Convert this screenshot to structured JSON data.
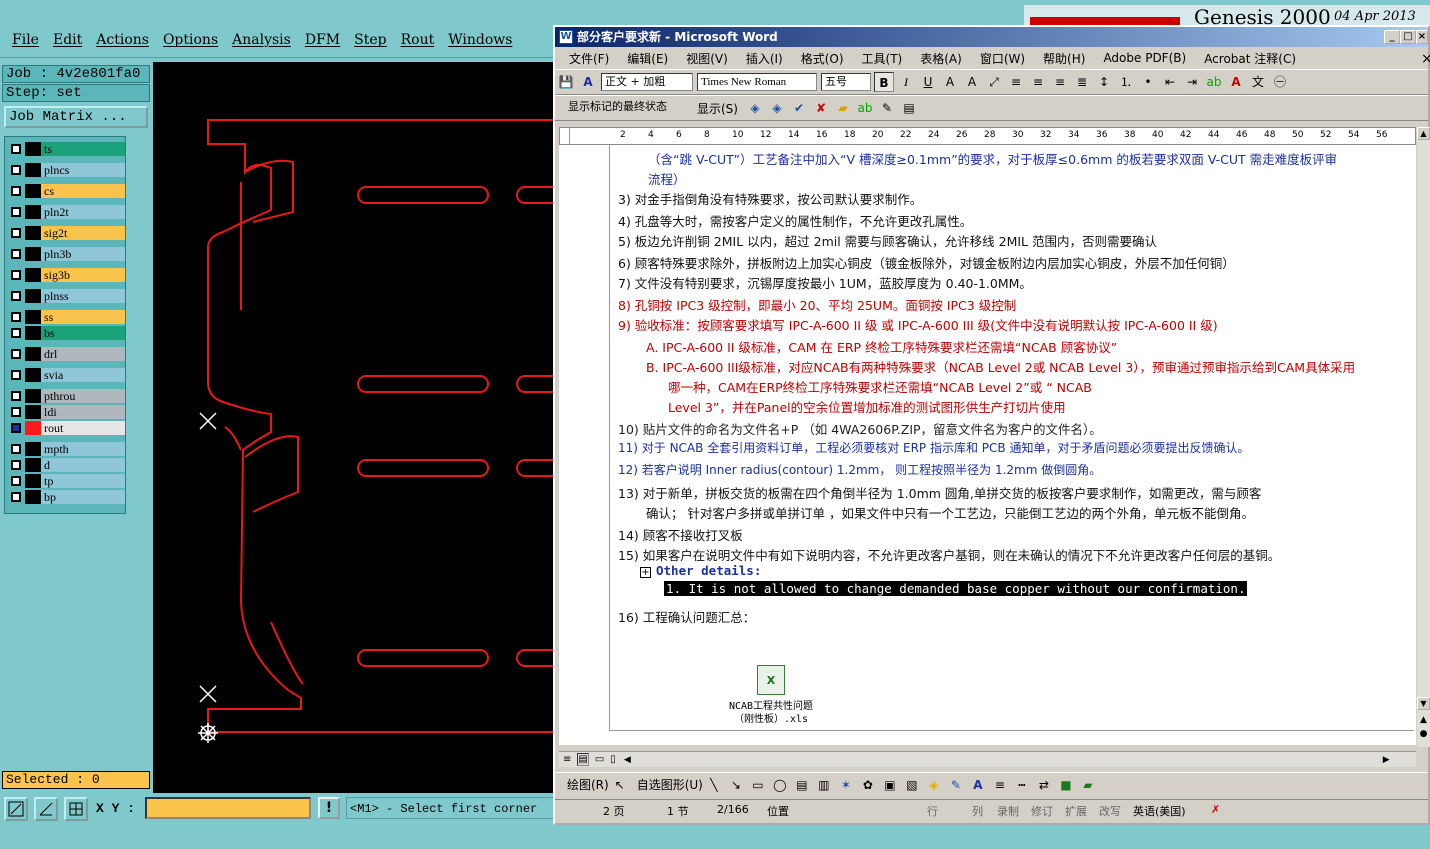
{
  "genesis": {
    "menu": [
      "File",
      "Edit",
      "Actions",
      "Options",
      "Analysis",
      "DFM",
      "Step",
      "Rout",
      "Windows"
    ],
    "job_label": "Job : 4v2e801fa0",
    "step_label": "Step: set",
    "job_matrix_button": "Job Matrix ...",
    "layers": [
      {
        "name": "ts",
        "color": "#1aa37a",
        "checked": false
      },
      {
        "name": "plncs",
        "color": "#8fc7d9",
        "checked": false
      },
      {
        "name": "cs",
        "color": "#f9c34c",
        "checked": false
      },
      {
        "name": "pln2t",
        "color": "#8fc7d9",
        "checked": false
      },
      {
        "name": "sig2t",
        "color": "#f9c34c",
        "checked": false
      },
      {
        "name": "pln3b",
        "color": "#8fc7d9",
        "checked": false
      },
      {
        "name": "sig3b",
        "color": "#f9c34c",
        "checked": false
      },
      {
        "name": "plnss",
        "color": "#8fc7d9",
        "checked": false
      },
      {
        "name": "ss",
        "color": "#f9c34c",
        "checked": false
      },
      {
        "name": "bs",
        "color": "#1aa37a",
        "checked": false
      },
      {
        "name": "drl",
        "color": "#b0b7bd",
        "checked": false
      },
      {
        "name": "svia",
        "color": "#8fc7d9",
        "checked": false
      },
      {
        "name": "pthrou",
        "color": "#b0b7bd",
        "checked": false
      },
      {
        "name": "ldi",
        "color": "#b0b7bd",
        "checked": false
      },
      {
        "name": "rout",
        "color": "#e6e6e6",
        "checked": true,
        "active_swatch": "#ff1a1a"
      },
      {
        "name": "mpth",
        "color": "#8fc7d9",
        "checked": false
      },
      {
        "name": "d",
        "color": "#8fc7d9",
        "checked": false
      },
      {
        "name": "tp",
        "color": "#8fc7d9",
        "checked": false
      },
      {
        "name": "bp",
        "color": "#8fc7d9",
        "checked": false
      }
    ],
    "selected_label": "Selected : 0",
    "xy_label": "X Y :",
    "xy_value": "",
    "bang_label": "!",
    "prompt": "<M1> - Select first corner",
    "brand_title": "Genesis 2000",
    "brand_date": "04 Apr 2013",
    "colors": {
      "background": "#7fc8cc",
      "panel": "#5bb6b9",
      "rout": "#e8191a",
      "selected": "#f9c34c"
    }
  },
  "word": {
    "title": "部分客户要求新 - Microsoft Word",
    "menu": [
      "文件(F)",
      "编辑(E)",
      "视图(V)",
      "插入(I)",
      "格式(O)",
      "工具(T)",
      "表格(A)",
      "窗口(W)",
      "帮助(H)",
      "Adobe PDF(B)",
      "Acrobat 注释(C)"
    ],
    "style_combo": "正文 + 加粗",
    "font_combo": "Times New Roman",
    "size_combo": "五号",
    "review_combo": "显示标记的最终状态",
    "show_button": "显示(S)",
    "ruler_numbers": [
      "2",
      "4",
      "6",
      "8",
      "10",
      "12",
      "14",
      "16",
      "18",
      "20",
      "22",
      "24",
      "26",
      "28",
      "30",
      "32",
      "34",
      "36",
      "38",
      "40",
      "42",
      "44",
      "46",
      "48",
      "50",
      "52",
      "54",
      "56"
    ],
    "doc_lines": [
      {
        "text": "（含“跳 V-CUT”）工艺备注中加入“V 槽深度≥0.1mm”的要求，对于板厚≤0.6mm 的板若要求双面 V-CUT 需走难度板评审",
        "cls": "blue",
        "x": 30
      },
      {
        "text": "流程）",
        "cls": "blue",
        "x": 30
      },
      {
        "text": "3)   对金手指倒角没有特殊要求，按公司默认要求制作。",
        "cls": "black",
        "x": 0
      },
      {
        "text": "4)   孔盘等大时，需按客户定义的属性制作，不允许更改孔属性。",
        "cls": "black",
        "x": 0
      },
      {
        "text": "5)   板边允许削铜 2MIL 以内，超过 2mil 需要与顾客确认，允许移线 2MIL 范围内，否则需要确认",
        "cls": "black",
        "x": 0
      },
      {
        "text": "6)   顾客特殊要求除外，拼板附边上加实心铜皮（镀金板除外，对镀金板附边内层加实心铜皮，外层不加任何铜）",
        "cls": "black",
        "x": 0
      },
      {
        "text": "7)   文件没有特别要求，沉锡厚度按最小 1UM，蓝胶厚度为 0.40-1.0MM。",
        "cls": "black",
        "x": 0
      },
      {
        "text": "8)   孔铜按 IPC3 级控制，即最小 20、平均 25UM。面铜按 IPC3 级控制",
        "cls": "red",
        "x": 0
      },
      {
        "text": "9)   验收标准：按顾客要求填写 IPC-A-600 II 级 或 IPC-A-600 III 级(文件中没有说明默认按 IPC-A-600 II 级)",
        "cls": "red",
        "x": 0
      },
      {
        "text": "A.  IPC-A-600 II 级标准，CAM 在 ERP 终检工序特殊要求栏还需填“NCAB 顾客协议”",
        "cls": "red",
        "x": 28
      },
      {
        "text": "B.  IPC-A-600 III级标准，对应NCAB有两种特殊要求（NCAB Level 2或 NCAB Level 3），预审通过预审指示给到CAM具体采用",
        "cls": "red",
        "x": 28
      },
      {
        "text": "哪一种，CAM在ERP终检工序特殊要求栏还需填“NCAB Level 2”或 “ NCAB",
        "cls": "red",
        "x": 50
      },
      {
        "text": "Level 3”，并在Panel的空余位置增加标准的测试图形供生产打切片使用",
        "cls": "red",
        "x": 50
      },
      {
        "text": "10) 贴片文件的命名为文件名+P （如 4WA2606P.ZIP，留意文件名为客户的文件名）。",
        "cls": "dark",
        "x": 0
      },
      {
        "text": "11) 对于 NCAB 全套引用资料订单，工程必须要核对 ERP 指示库和 PCB 通知单，对于矛盾问题必须要提出反馈确认。",
        "cls": "blue",
        "x": 0
      },
      {
        "text": "12) 若客户说明 Inner radius(contour) 1.2mm，   则工程按照半径为 1.2mm 做倒圆角。",
        "cls": "blue",
        "x": 0
      },
      {
        "text": "13) 对于新单，拼板交货的板需在四个角倒半径为  1.0mm 圆角,单拼交货的板按客户要求制作，如需更改，需与顾客",
        "cls": "black",
        "x": 0
      },
      {
        "text": "确认；  针对客户多拼或单拼订单 ，如果文件中只有一个工艺边，只能倒工艺边的两个外角，单元板不能倒角。",
        "cls": "black",
        "x": 28
      },
      {
        "text": "14) 顾客不接收打叉板",
        "cls": "black",
        "x": 0
      },
      {
        "text": "15) 如果客户在说明文件中有如下说明内容，不允许更改客户基铜，则在未确认的情况下不允许更改客户任何层的基铜。",
        "cls": "black",
        "x": 0
      },
      {
        "text": "Other details:",
        "cls": "blue",
        "x": 38
      },
      {
        "text": "1. It is not allowed to change demanded base copper without our confirmation.",
        "cls": "sel",
        "x": 46
      },
      {
        "text": "16) 工程确认问题汇总：",
        "cls": "black",
        "x": 0
      }
    ],
    "embed_label_1": "NCAB工程共性问题",
    "embed_label_2": "（刚性板）.xls",
    "draw_label": "绘图(R)",
    "autoshape_label": "自选图形(U)",
    "status": {
      "page": "2 页",
      "section": "1 节",
      "pages": "2/166",
      "position": "位置",
      "line": "行",
      "col": "列",
      "rec": "录制",
      "trk": "修订",
      "ext": "扩展",
      "ovr": "改写",
      "lang": "英语(美国)"
    }
  }
}
